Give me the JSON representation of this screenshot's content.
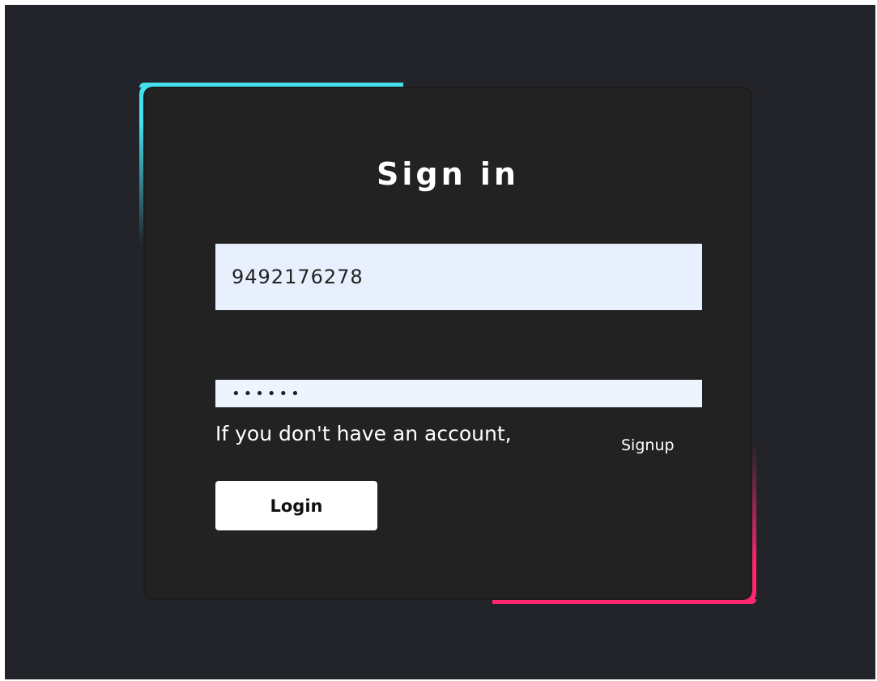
{
  "form": {
    "title": "Sign in",
    "phone_value": "9492176278",
    "password_masked": "••••••",
    "helper_text": "If you don't have an account,",
    "signup_label": "Signup",
    "login_label": "Login"
  },
  "colors": {
    "background": "#23242a",
    "card": "#222222",
    "accent_top_left": "#45e0f0",
    "accent_bottom_right": "#ff2770"
  }
}
